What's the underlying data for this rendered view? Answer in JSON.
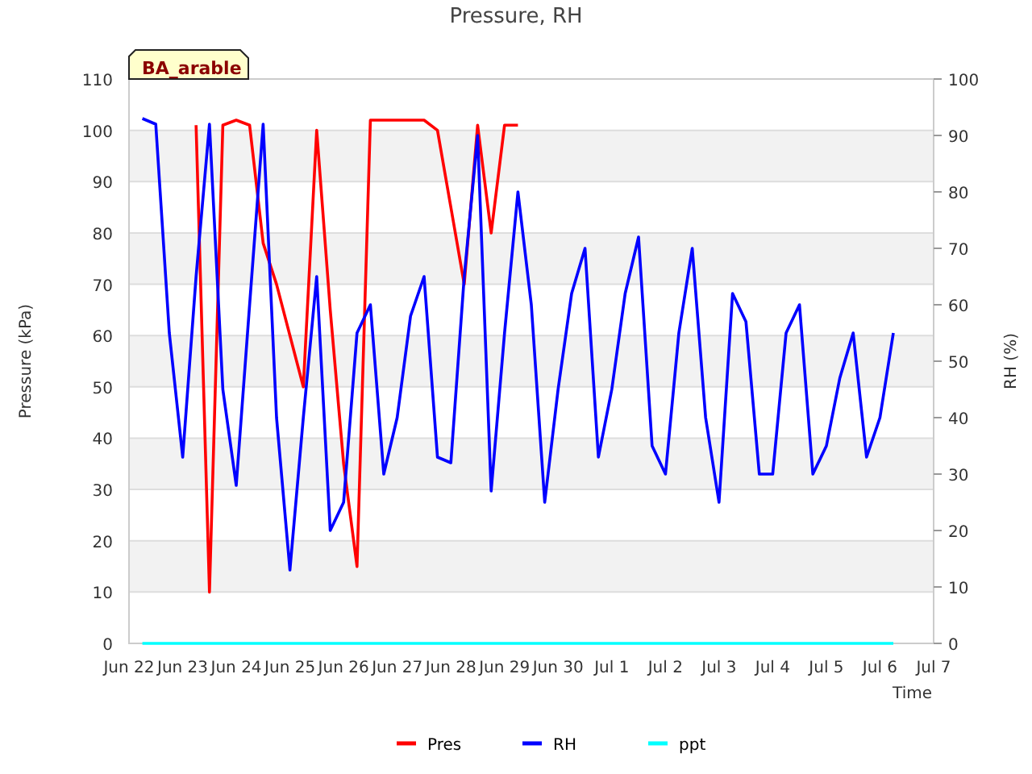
{
  "site_label": "BA_arable",
  "chart_data": {
    "type": "line",
    "title": "Pressure, RH",
    "xlabel": "Time",
    "ylabel": "Pressure (kPa)",
    "y2label": "RH (%)",
    "categories": [
      "Jun 22",
      null,
      null,
      null,
      "Jun 23",
      null,
      null,
      null,
      "Jun 24",
      null,
      null,
      null,
      "Jun 25",
      null,
      null,
      null,
      "Jun 26",
      null,
      null,
      null,
      "Jun 27",
      null,
      null,
      null,
      "Jun 28",
      null,
      null,
      null,
      "Jun 29",
      null,
      null,
      null,
      "Jun 30",
      null,
      null,
      null,
      "Jul 1",
      null,
      null,
      null,
      "Jul 2",
      null,
      null,
      null,
      "Jul 3",
      null,
      null,
      null,
      "Jul 4",
      null,
      null,
      null,
      "Jul 5",
      null,
      null,
      null,
      "Jul 6",
      null,
      null,
      null,
      "Jul 7"
    ],
    "grid": true,
    "legend": "bottom",
    "ylim": [
      0,
      110
    ],
    "y2lim": [
      0,
      100
    ],
    "yticks": [
      0,
      10,
      20,
      30,
      40,
      50,
      60,
      70,
      80,
      90,
      100,
      110
    ],
    "y2ticks": [
      0,
      10,
      20,
      30,
      40,
      50,
      60,
      70,
      80,
      90,
      100
    ],
    "series": [
      {
        "name": "Pres",
        "color": "#ff0000",
        "values": [
          null,
          null,
          null,
          null,
          null,
          101,
          10,
          101,
          102,
          101,
          78,
          70,
          60,
          50,
          100,
          65,
          35,
          15,
          102,
          102,
          102,
          102,
          102,
          100,
          85,
          70,
          101,
          80,
          101,
          101,
          null,
          null,
          null,
          null,
          null,
          null,
          null,
          null,
          null,
          null,
          null,
          null,
          null,
          null,
          null,
          null,
          null,
          null,
          null,
          null,
          null,
          null,
          null,
          null,
          null,
          null,
          null,
          null,
          null,
          null,
          null
        ]
      },
      {
        "name": "RH",
        "color": "#0000ff",
        "axis": "y2",
        "values": [
          null,
          93,
          92,
          55,
          33,
          65,
          92,
          45,
          28,
          60,
          92,
          40,
          13,
          40,
          65,
          20,
          25,
          55,
          60,
          30,
          40,
          58,
          65,
          33,
          32,
          65,
          90,
          27,
          55,
          80,
          60,
          25,
          45,
          62,
          70,
          33,
          45,
          62,
          72,
          35,
          30,
          55,
          70,
          40,
          25,
          62,
          57,
          30,
          30,
          55,
          60,
          30,
          35,
          47,
          55,
          33,
          40,
          55,
          null,
          null,
          null
        ]
      },
      {
        "name": "ppt",
        "color": "#00ffff",
        "axis": "y2",
        "values": [
          null,
          0,
          0,
          0,
          0,
          0,
          0,
          0,
          0,
          0,
          0,
          0,
          0,
          0,
          0,
          0,
          0,
          0,
          0,
          0,
          0,
          0,
          0,
          0,
          0,
          0,
          0,
          0,
          0,
          0,
          0,
          0,
          0,
          0,
          0,
          0,
          0,
          0,
          0,
          0,
          0,
          0,
          0,
          0,
          0,
          0,
          0,
          0,
          0,
          0,
          0,
          0,
          0,
          0,
          0,
          0,
          0,
          0,
          null,
          null,
          null
        ]
      }
    ]
  }
}
